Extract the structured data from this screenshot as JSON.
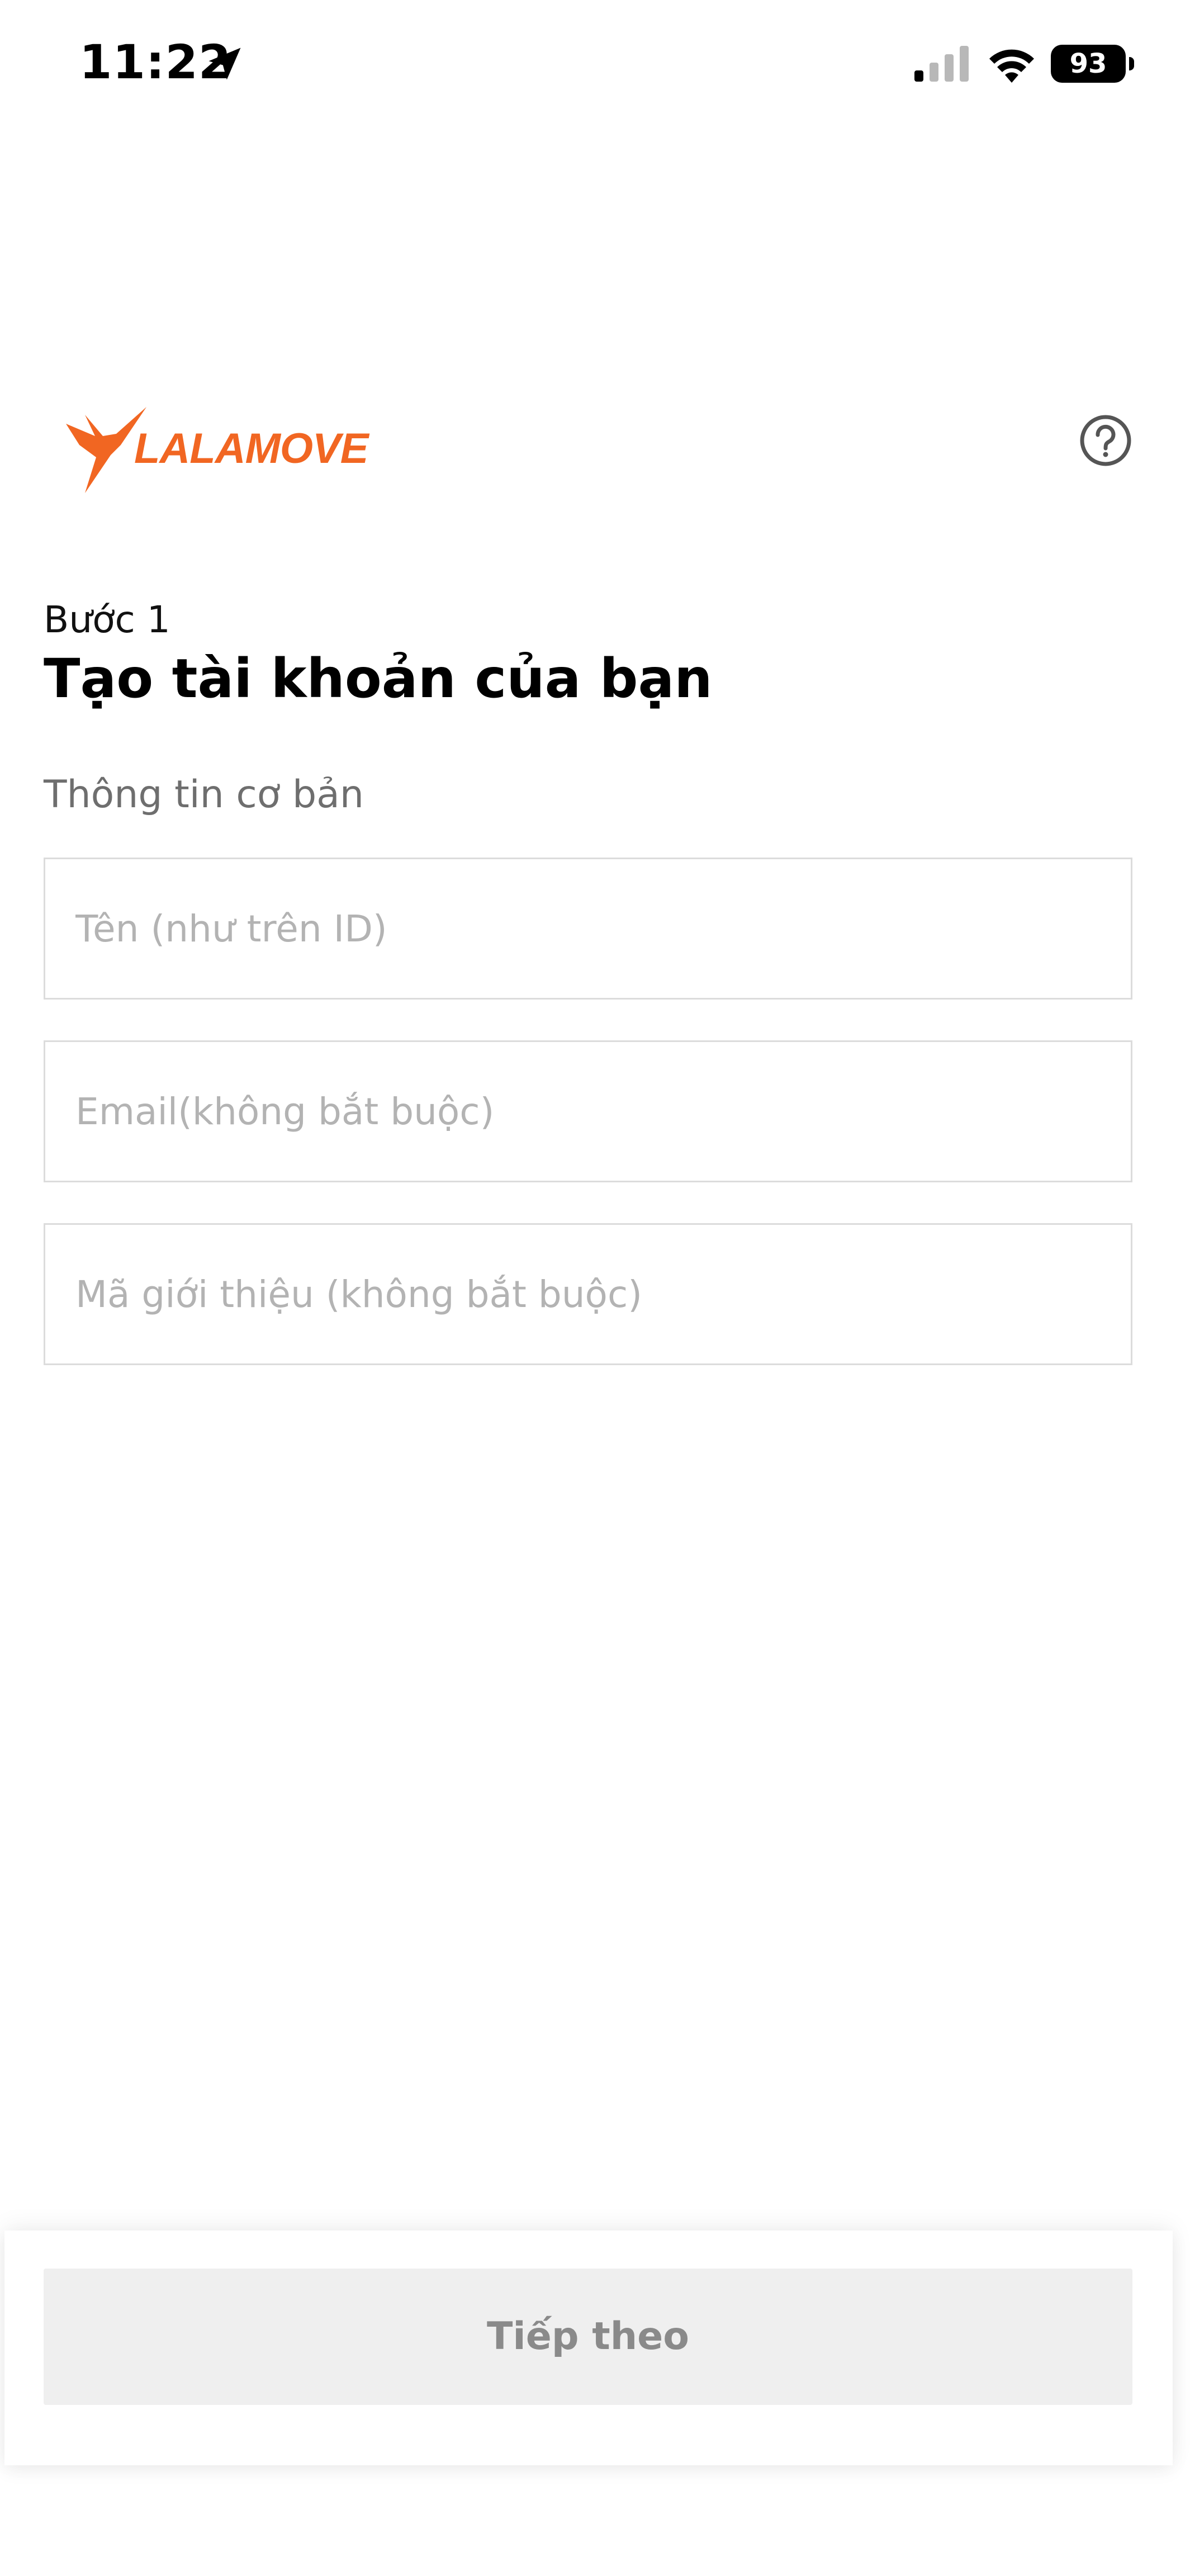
{
  "status_bar": {
    "time": "11:22",
    "battery": "93"
  },
  "header": {
    "logo_text": "LALAMOVE",
    "brand_color": "#f16622"
  },
  "step": {
    "label": "Bước 1",
    "title": "Tạo tài khoản của bạn"
  },
  "form": {
    "section_label": "Thông tin cơ bản",
    "name_placeholder": "Tên (như trên ID)",
    "email_placeholder": "Email(không bắt buộc)",
    "referral_placeholder": "Mã giới thiệu (không bắt buộc)"
  },
  "footer": {
    "next_label": "Tiếp theo"
  }
}
